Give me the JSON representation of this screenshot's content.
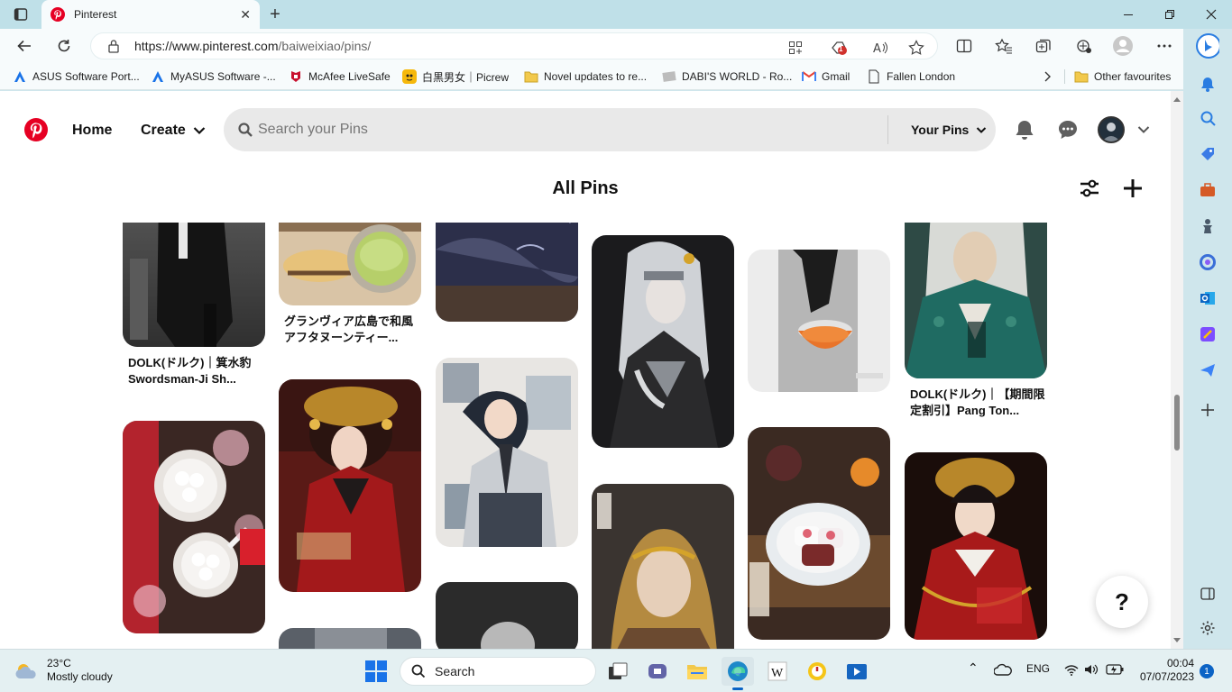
{
  "browser": {
    "tab_title": "Pinterest",
    "tab_close": "✕",
    "new_tab": "+",
    "url_host": "https://www.pinterest.com",
    "url_path": "/baiweixiao/pins/",
    "window_min": "—",
    "window_max": "❐",
    "window_close": "✕",
    "read_aloud_badge": "1"
  },
  "favourites": [
    {
      "label": "ASUS Software Port...",
      "icon": "asus-icon"
    },
    {
      "label": "MyASUS Software -...",
      "icon": "asus-icon"
    },
    {
      "label": "McAfee LiveSafe",
      "icon": "mcafee-icon"
    },
    {
      "label": "白黒男女｜Picrew",
      "icon": "picrew-icon"
    },
    {
      "label": "Novel updates to re...",
      "icon": "folder-icon"
    },
    {
      "label": "DABI'S WORLD - Ro...",
      "icon": "page-icon"
    },
    {
      "label": "Gmail",
      "icon": "gmail-icon"
    },
    {
      "label": "Fallen London",
      "icon": "document-icon"
    },
    {
      "label": "Other favourites",
      "icon": "folder-icon"
    }
  ],
  "pinterest": {
    "home": "Home",
    "create": "Create",
    "search_placeholder": "Search your Pins",
    "your_pins": "Your Pins",
    "title": "All Pins",
    "help": "?",
    "pins": [
      {
        "caption": "DOLK(ドルク)｜箕水豹 Swordsman-Ji Sh..."
      },
      {
        "caption": "グランヴィア広島で和風アフタヌーンティー..."
      },
      {
        "caption": "DOLK(ドルク)｜【期間限定割引】Pang Ton..."
      }
    ]
  },
  "taskbar": {
    "temp": "23°C",
    "weather": "Mostly cloudy",
    "search": "Search",
    "lang": "ENG",
    "time": "00:04",
    "date": "07/07/2023",
    "notifications": "1",
    "tray_up": "⌃"
  },
  "colors": {
    "pinterest_red": "#e60023",
    "edge_frame": "#bfe0e8"
  }
}
